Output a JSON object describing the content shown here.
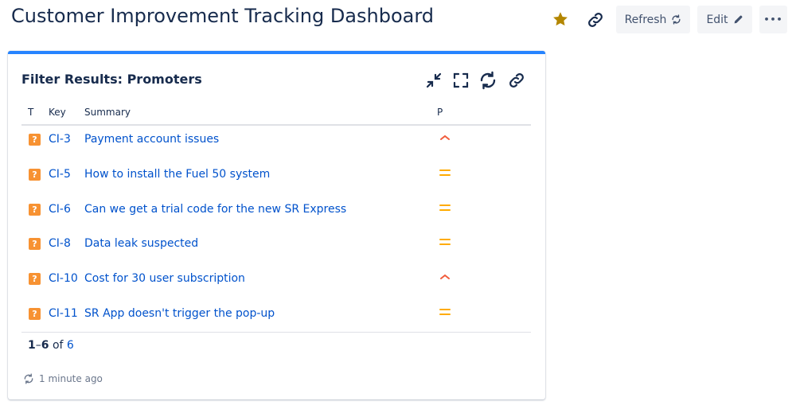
{
  "header": {
    "title": "Customer Improvement Tracking Dashboard",
    "refresh_label": "Refresh",
    "edit_label": "Edit",
    "more_label": "•••"
  },
  "gadget": {
    "title": "Filter Results: Promoters",
    "columns": {
      "type": "T",
      "key": "Key",
      "summary": "Summary",
      "priority": "P"
    },
    "rows": [
      {
        "key": "CI-3",
        "summary": "Payment account issues",
        "priority": "high"
      },
      {
        "key": "CI-5",
        "summary": "How to install the Fuel 50 system",
        "priority": "medium"
      },
      {
        "key": "CI-6",
        "summary": "Can we get a trial code for the new SR Express",
        "priority": "medium"
      },
      {
        "key": "CI-8",
        "summary": "Data leak suspected",
        "priority": "medium"
      },
      {
        "key": "CI-10",
        "summary": "Cost for 30 user subscription",
        "priority": "high"
      },
      {
        "key": "CI-11",
        "summary": "SR App doesn't trigger the pop-up",
        "priority": "medium"
      }
    ],
    "issue_icon_glyph": "?",
    "pager": {
      "start": "1",
      "dash": "–",
      "end": "6",
      "of": "of",
      "total": "6"
    },
    "updated": "1 minute ago"
  },
  "colors": {
    "accent": "#2684ff",
    "link": "#0052cc",
    "star": "#b38600",
    "high": "#f15c3c",
    "medium": "#ffab00",
    "issue": "#f79232"
  }
}
